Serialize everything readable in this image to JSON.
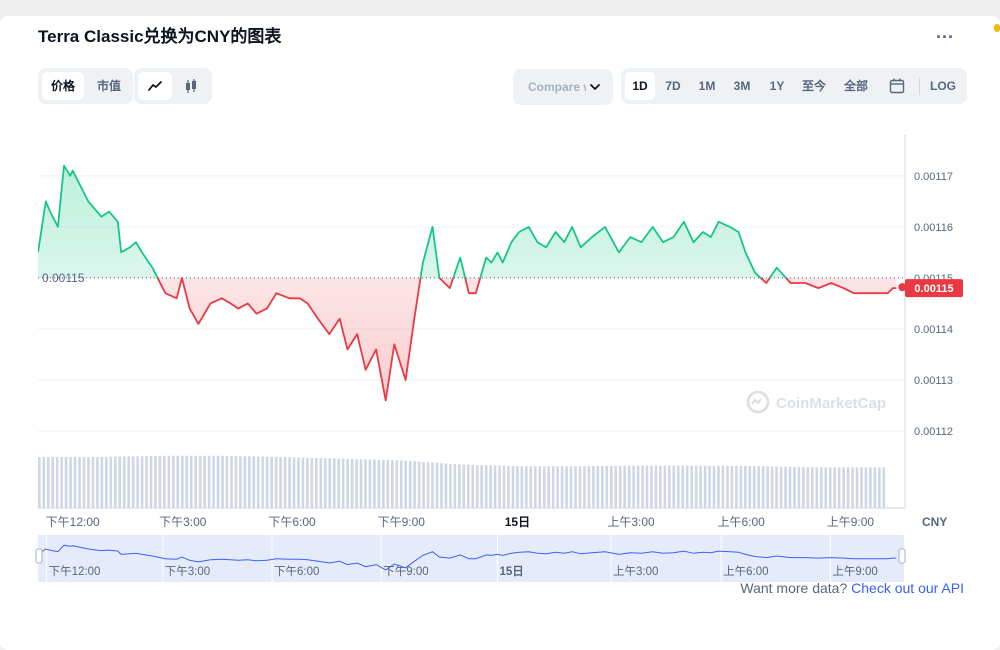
{
  "header": {
    "title": "Terra Classic兑换为CNY的图表",
    "more_label": "..."
  },
  "toolbar": {
    "metric_tabs": [
      "价格",
      "市值"
    ],
    "active_metric": "价格",
    "chart_styles": [
      "line-chart-icon",
      "candlestick-icon"
    ],
    "active_style": "line-chart-icon",
    "compare_label": "Compare with",
    "ranges": [
      "1D",
      "7D",
      "1M",
      "3M",
      "1Y",
      "至今",
      "全部"
    ],
    "active_range": "1D",
    "calendar_icon": "calendar-icon",
    "log_label": "LOG"
  },
  "colors": {
    "up": "#16c784",
    "down": "#ea3943",
    "accent": "#3861fb"
  },
  "chart_data": {
    "type": "line",
    "baseline": 0.00115,
    "baseline_label": "0.00115",
    "current_price_label": "0.00115",
    "currency_label": "CNY",
    "yticks": [
      "0.00117",
      "0.00116",
      "0.00115",
      "0.00114",
      "0.00113",
      "0.00112"
    ],
    "ytick_values": [
      0.00117,
      0.00116,
      0.00115,
      0.00114,
      0.00113,
      0.00112
    ],
    "ylim": [
      0.001111,
      0.001178
    ],
    "xlim": [
      0,
      100
    ],
    "xticks": [
      "下午12:00",
      "下午3:00",
      "下午6:00",
      "下午9:00",
      "15日",
      "上午3:00",
      "上午6:00",
      "上午9:00"
    ],
    "xtick_positions": [
      1,
      13.7,
      26.3,
      38.9,
      52.3,
      65.4,
      78.1,
      90.7
    ],
    "grid": true,
    "x": [
      0,
      0.9,
      1.4,
      2.3,
      3.0,
      3.7,
      4.0,
      4.9,
      5.8,
      6.8,
      7.3,
      8.2,
      9.2,
      9.6,
      10.6,
      11.3,
      12.0,
      13.2,
      14.7,
      16.0,
      16.6,
      17.5,
      18.5,
      19.9,
      21.2,
      22.2,
      23.1,
      24.2,
      25.2,
      26.4,
      27.5,
      29.0,
      30.2,
      31.1,
      32.3,
      33.6,
      34.8,
      35.7,
      36.8,
      37.8,
      39.0,
      40.1,
      41.1,
      42.4,
      43.4,
      44.4,
      45.5,
      46.3,
      47.5,
      48.7,
      49.7,
      50.5,
      51.7,
      52.3,
      53.0,
      53.6,
      54.6,
      55.5,
      56.6,
      57.6,
      58.6,
      59.7,
      60.7,
      61.6,
      62.6,
      63.9,
      65.4,
      67.0,
      68.3,
      69.6,
      70.9,
      72.1,
      73.3,
      74.5,
      75.6,
      76.7,
      77.6,
      78.5,
      79.8,
      80.8,
      81.6,
      82.7,
      84.0,
      85.2,
      86.8,
      88.5,
      90.0,
      91.5,
      92.9,
      94.1,
      95.3,
      96.5,
      97.5,
      98.0,
      98.6,
      99.0
    ],
    "values": [
      0.001155,
      0.001165,
      0.001163,
      0.00116,
      0.001172,
      0.00117,
      0.001171,
      0.001168,
      0.001165,
      0.001163,
      0.001162,
      0.001163,
      0.001161,
      0.001155,
      0.001156,
      0.001157,
      0.001155,
      0.001152,
      0.001147,
      0.001146,
      0.00115,
      0.001144,
      0.001141,
      0.001145,
      0.001146,
      0.001145,
      0.001144,
      0.001145,
      0.001143,
      0.001144,
      0.001147,
      0.001146,
      0.001146,
      0.001145,
      0.001142,
      0.001139,
      0.001142,
      0.001136,
      0.001139,
      0.001132,
      0.001136,
      0.001126,
      0.001137,
      0.00113,
      0.001142,
      0.001153,
      0.00116,
      0.00115,
      0.001148,
      0.001154,
      0.001147,
      0.001147,
      0.001154,
      0.001153,
      0.001155,
      0.001153,
      0.001157,
      0.001159,
      0.00116,
      0.001157,
      0.001156,
      0.001159,
      0.001157,
      0.00116,
      0.001156,
      0.001158,
      0.00116,
      0.001155,
      0.001158,
      0.001157,
      0.00116,
      0.001157,
      0.001158,
      0.001161,
      0.001157,
      0.001159,
      0.001158,
      0.001161,
      0.00116,
      0.001159,
      0.001155,
      0.001151,
      0.001149,
      0.001152,
      0.001149,
      0.001149,
      0.001148,
      0.001149,
      0.001148,
      0.001147,
      0.001147,
      0.001147,
      0.001147,
      0.001147,
      0.001148,
      0.001148
    ],
    "volume_levels": [
      0.88,
      0.88,
      0.9,
      0.9,
      0.88,
      0.85,
      0.82,
      0.75,
      0.72,
      0.72,
      0.73,
      0.73,
      0.72,
      0.7,
      0.7
    ]
  },
  "navigator": {
    "labels": [
      "下午12:00",
      "下午3:00",
      "下午6:00",
      "下午9:00",
      "15日",
      "上午3:00",
      "上午6:00",
      "上午9:00"
    ]
  },
  "footer": {
    "prefix": "Want more data?",
    "link": "Check out our API"
  },
  "watermark": "CoinMarketCap"
}
